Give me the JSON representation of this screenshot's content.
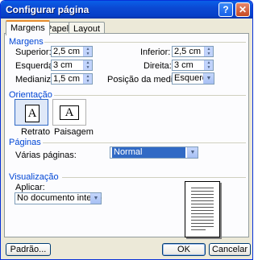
{
  "window": {
    "title": "Configurar página",
    "help_label": "?",
    "close_label": "✕"
  },
  "tabs": [
    {
      "label": "Margens",
      "active": true
    },
    {
      "label": "Papel",
      "active": false
    },
    {
      "label": "Layout",
      "active": false
    }
  ],
  "margins": {
    "group_title": "Margens",
    "superior": {
      "label": "Superior:",
      "value": "2,5 cm"
    },
    "esquerda": {
      "label": "Esquerda:",
      "value": "3 cm"
    },
    "medianiz": {
      "label": "Medianiz:",
      "value": "1,5 cm"
    },
    "inferior": {
      "label": "Inferior:",
      "value": "2,5 cm"
    },
    "direita": {
      "label": "Direita:",
      "value": "3 cm"
    },
    "posicao": {
      "label": "Posição da medianiz:",
      "value": "Esquerda"
    }
  },
  "orientation": {
    "group_title": "Orientação",
    "retrato": {
      "label": "Retrato",
      "glyph": "A"
    },
    "paisagem": {
      "label": "Paisagem",
      "glyph": "A"
    }
  },
  "pages": {
    "group_title": "Páginas",
    "varias_label": "Várias páginas:",
    "varias_value": "Normal"
  },
  "preview": {
    "group_title": "Visualização",
    "aplicar_label": "Aplicar:",
    "aplicar_value": "No documento inteiro"
  },
  "buttons": {
    "padrao": "Padrão...",
    "ok": "OK",
    "cancelar": "Cancelar"
  },
  "colors": {
    "titlebar": "#0b49d3",
    "group_title": "#0046d5",
    "dialog_bg": "#ece9d8"
  },
  "icons": {
    "spin_up": "▲",
    "spin_down": "▼",
    "dropdown": "▼"
  }
}
